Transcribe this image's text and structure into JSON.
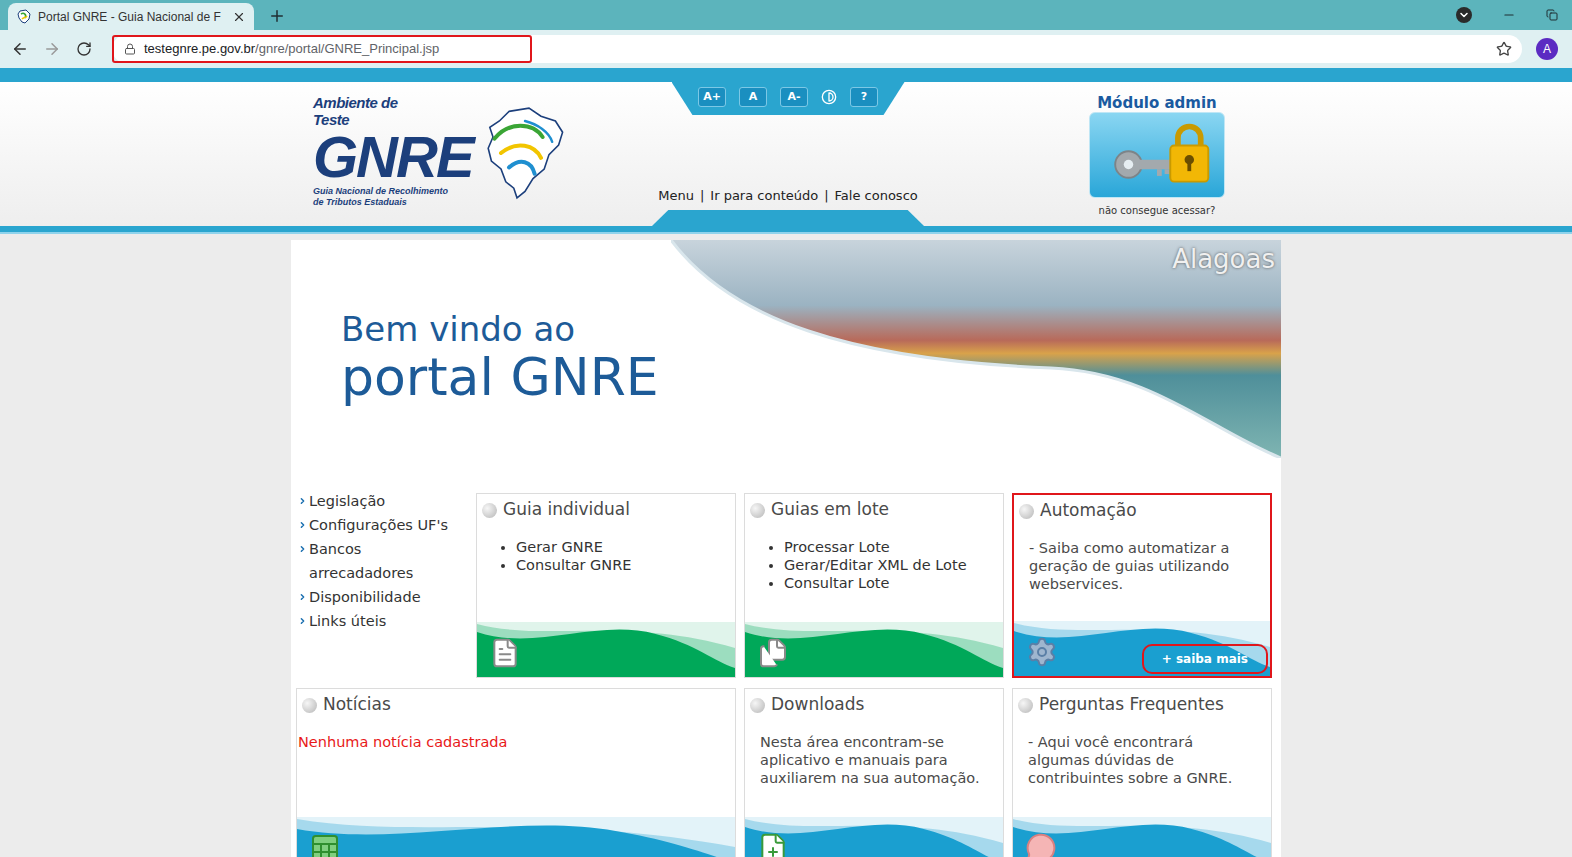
{
  "browser": {
    "tab_title": "Portal GNRE - Guia Nacional de F",
    "url_host": "testegnre.pe.gov.br",
    "url_path": "/gnre/portal/GNRE_Principal.jsp",
    "url_highlighted": true,
    "avatar": "A"
  },
  "header": {
    "logo": {
      "env_lines": [
        "Ambiente de",
        "Teste"
      ],
      "name": "GNRE",
      "subtitle_lines": [
        "Guia Nacional de Recolhimento",
        "de Tributos Estaduais"
      ]
    },
    "accessibility_buttons": [
      "A+",
      "A",
      "A-"
    ],
    "help_button": "?",
    "nav_links": [
      "Menu",
      "Ir para conteúdo",
      "Fale conosco"
    ],
    "nav_separator": "|",
    "admin": {
      "title": "Módulo admin",
      "help": "não consegue acessar?"
    }
  },
  "banner": {
    "line1": "Bem vindo ao",
    "line2": "portal GNRE",
    "region": "Alagoas"
  },
  "sidebar": {
    "items": [
      "Legislação",
      "Configurações UF's",
      "Bancos arrecadadores",
      "Disponibilidade",
      "Links úteis"
    ]
  },
  "cards": [
    {
      "title": "Guia individual",
      "kind": "list",
      "items": [
        "Gerar GNRE",
        "Consultar GNRE"
      ],
      "color": "#00a859",
      "highlighted": false
    },
    {
      "title": "Guias em lote",
      "kind": "list",
      "items": [
        "Processar Lote",
        "Gerar/Editar XML de Lote",
        "Consultar Lote"
      ],
      "color": "#00a859",
      "highlighted": false
    },
    {
      "title": "Automação",
      "kind": "text",
      "text": "- Saiba como automatizar a geração de guias utilizando webservices.",
      "link": "+ saiba mais",
      "link_highlighted": true,
      "color": "#1a9fd0",
      "highlighted": true
    },
    {
      "title": "Notícias",
      "kind": "alert",
      "text": "Nenhuma notícia cadastrada",
      "color": "#1a9fd0",
      "highlighted": false
    },
    {
      "title": "Downloads",
      "kind": "text",
      "text": "Nesta área encontram-se aplicativo e manuais para auxiliarem na sua automação.",
      "color": "#1a9fd0",
      "highlighted": false
    },
    {
      "title": "Perguntas Frequentes",
      "kind": "text",
      "text": "- Aqui você encontrará algumas dúvidas de contribuintes sobre a GNRE.",
      "color": "#1a9fd0",
      "highlighted": false
    }
  ]
}
